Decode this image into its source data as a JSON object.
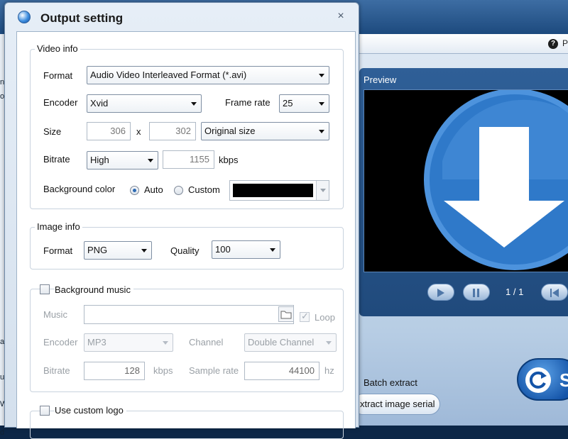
{
  "window": {
    "title": "Output setting",
    "close_glyph": "×",
    "icon": "app-logo-icon"
  },
  "video_info": {
    "legend": "Video info",
    "format_label": "Format",
    "format_value": "Audio Video Interleaved Format (*.avi)",
    "encoder_label": "Encoder",
    "encoder_value": "Xvid",
    "frame_rate_label": "Frame rate",
    "frame_rate_value": "25",
    "size_label": "Size",
    "width_value": "306",
    "size_separator": "x",
    "height_value": "302",
    "size_mode_value": "Original size",
    "bitrate_label": "Bitrate",
    "bitrate_quality_value": "High",
    "bitrate_value": "1155",
    "bitrate_unit": "kbps",
    "bg_color_label": "Background color",
    "bg_auto_label": "Auto",
    "bg_custom_label": "Custom",
    "bg_auto_selected": true,
    "bg_color_value": "#000000"
  },
  "image_info": {
    "legend": "Image info",
    "format_label": "Format",
    "format_value": "PNG",
    "quality_label": "Quality",
    "quality_value": "100"
  },
  "background_music": {
    "legend": "Background music",
    "enabled": false,
    "music_label": "Music",
    "music_value": "",
    "loop_label": "Loop",
    "loop_checked": true,
    "encoder_label": "Encoder",
    "encoder_value": "MP3",
    "channel_label": "Channel",
    "channel_value": "Double Channel",
    "bitrate_label": "Bitrate",
    "bitrate_value": "128",
    "bitrate_unit": "kbps",
    "sample_rate_label": "Sample rate",
    "sample_rate_value": "44100",
    "sample_rate_unit": "hz"
  },
  "custom_logo": {
    "legend": "Use custom logo",
    "enabled": false
  },
  "background_app": {
    "help_text": "P",
    "preview_label": "Preview",
    "page_indicator": "1 / 1",
    "batch_extract_label": "Batch extract",
    "extract_button_label": "xtract image serial",
    "big_button_label": "S",
    "left_marks": [
      "n",
      "o",
      "a",
      "u",
      "W",
      "d"
    ]
  },
  "colors": {
    "accent": "#2d6ab3",
    "preview_circle": "#2f79c9",
    "dialog_bg": "#d4e0ed"
  }
}
